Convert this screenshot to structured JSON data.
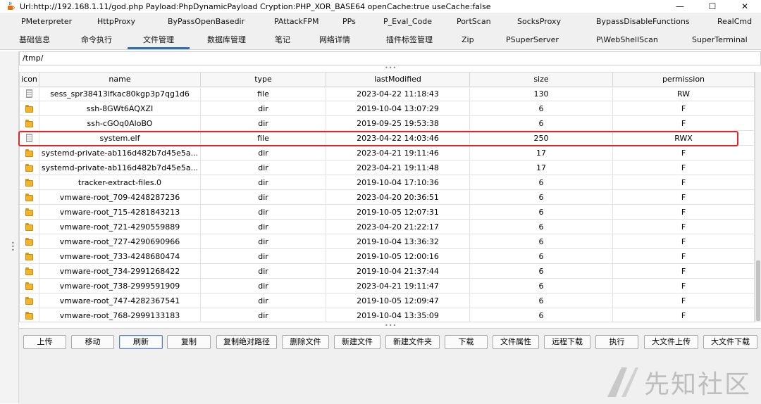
{
  "window": {
    "title": "Url:http://192.168.1.11/god.php Payload:PhpDynamicPayload Cryption:PHP_XOR_BASE64 openCache:true useCache:false",
    "minimize_glyph": "—",
    "maximize_glyph": "☐",
    "close_glyph": "✕"
  },
  "tabs_row1": [
    "PMeterpreter",
    "HttpProxy",
    "ByPassOpenBasedir",
    "PAttackFPM",
    "PPs",
    "P_Eval_Code",
    "PortScan",
    "SocksProxy",
    "BypassDisableFunctions",
    "RealCmd"
  ],
  "tabs_row2": [
    "基础信息",
    "命令执行",
    "文件管理",
    "数据库管理",
    "笔记",
    "网络详情",
    "插件标签管理",
    "Zip",
    "PSuperServer",
    "P\\WebShellScan",
    "SuperTerminal"
  ],
  "active_tab": "文件管理",
  "path": "/tmp/",
  "splitter_glyph": "•••",
  "table": {
    "headers": [
      "icon",
      "name",
      "type",
      "lastModified",
      "size",
      "permission"
    ],
    "rows": [
      {
        "icon": "file-icon",
        "name": "sess_spr38413lfkac80kgp3p7qg1d6",
        "type": "file",
        "lastModified": "2023-04-22 11:18:43",
        "size": "130",
        "permission": "RW"
      },
      {
        "icon": "folder-icon",
        "name": "ssh-8GWt6AQXZI",
        "type": "dir",
        "lastModified": "2019-10-04 13:07:29",
        "size": "6",
        "permission": "F"
      },
      {
        "icon": "folder-icon",
        "name": "ssh-cGOq0AloBO",
        "type": "dir",
        "lastModified": "2019-09-25 19:53:38",
        "size": "6",
        "permission": "F"
      },
      {
        "icon": "file-icon",
        "name": "system.elf",
        "type": "file",
        "lastModified": "2023-04-22 14:03:46",
        "size": "250",
        "permission": "RWX"
      },
      {
        "icon": "folder-icon",
        "name": "systemd-private-ab116d482b7d45e5a...",
        "type": "dir",
        "lastModified": "2023-04-21 19:11:46",
        "size": "17",
        "permission": "F"
      },
      {
        "icon": "folder-icon",
        "name": "systemd-private-ab116d482b7d45e5a...",
        "type": "dir",
        "lastModified": "2023-04-21 19:11:48",
        "size": "17",
        "permission": "F"
      },
      {
        "icon": "folder-icon",
        "name": "tracker-extract-files.0",
        "type": "dir",
        "lastModified": "2019-10-04 17:10:36",
        "size": "6",
        "permission": "F"
      },
      {
        "icon": "folder-icon",
        "name": "vmware-root_709-4248287236",
        "type": "dir",
        "lastModified": "2023-04-20 20:36:51",
        "size": "6",
        "permission": "F"
      },
      {
        "icon": "folder-icon",
        "name": "vmware-root_715-4281843213",
        "type": "dir",
        "lastModified": "2019-10-05 12:07:31",
        "size": "6",
        "permission": "F"
      },
      {
        "icon": "folder-icon",
        "name": "vmware-root_721-4290559889",
        "type": "dir",
        "lastModified": "2023-04-20 21:22:17",
        "size": "6",
        "permission": "F"
      },
      {
        "icon": "folder-icon",
        "name": "vmware-root_727-4290690966",
        "type": "dir",
        "lastModified": "2019-10-04 13:36:32",
        "size": "6",
        "permission": "F"
      },
      {
        "icon": "folder-icon",
        "name": "vmware-root_733-4248680474",
        "type": "dir",
        "lastModified": "2019-10-05 12:00:16",
        "size": "6",
        "permission": "F"
      },
      {
        "icon": "folder-icon",
        "name": "vmware-root_734-2991268422",
        "type": "dir",
        "lastModified": "2019-10-04 21:37:44",
        "size": "6",
        "permission": "F"
      },
      {
        "icon": "folder-icon",
        "name": "vmware-root_738-2999591909",
        "type": "dir",
        "lastModified": "2023-04-21 19:11:47",
        "size": "6",
        "permission": "F"
      },
      {
        "icon": "folder-icon",
        "name": "vmware-root_747-4282367541",
        "type": "dir",
        "lastModified": "2019-10-05 12:09:47",
        "size": "6",
        "permission": "F"
      },
      {
        "icon": "folder-icon",
        "name": "vmware-root_768-2999133183",
        "type": "dir",
        "lastModified": "2019-10-04 13:35:09",
        "size": "6",
        "permission": "F"
      }
    ]
  },
  "buttons": [
    "上传",
    "移动",
    "刷新",
    "复制",
    "复制绝对路径",
    "删除文件",
    "新建文件",
    "新建文件夹",
    "下载",
    "文件属性",
    "远程下载",
    "执行",
    "大文件上传",
    "大文件下载"
  ],
  "focused_button": "刷新",
  "watermark": {
    "text": "先知社区"
  },
  "colors": {
    "highlight": "#e0262b",
    "active_tab_underline": "#2f6fb3"
  }
}
